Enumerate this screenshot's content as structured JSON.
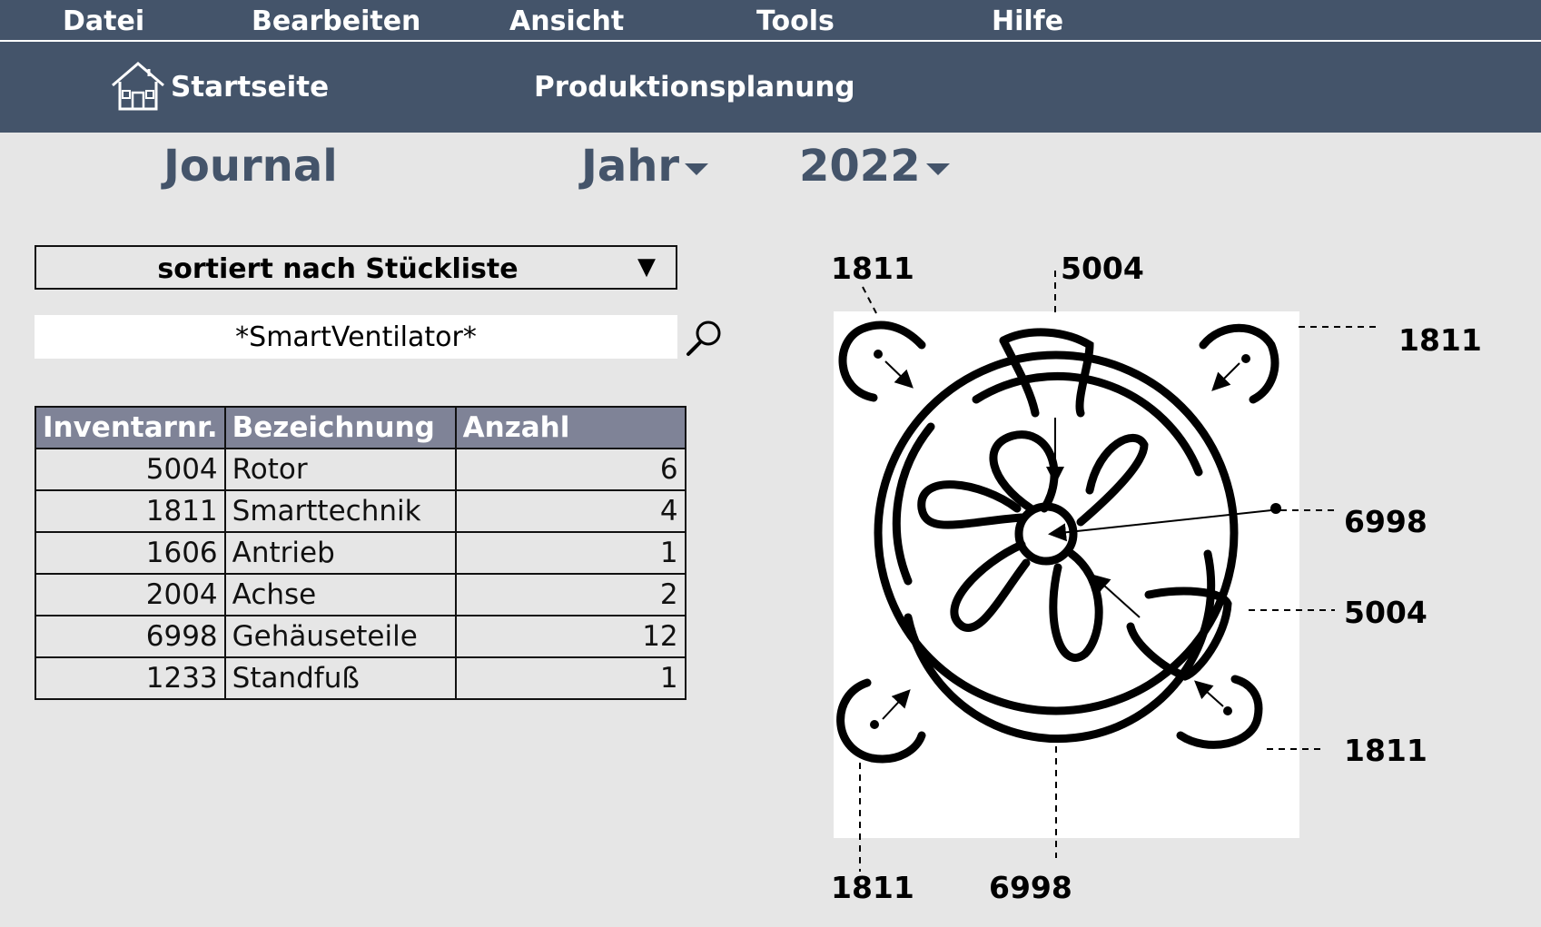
{
  "menu": {
    "items": [
      "Datei",
      "Bearbeiten",
      "Ansicht",
      "Tools",
      "Hilfe"
    ]
  },
  "nav": {
    "home_label": "Startseite",
    "production_label": "Produktionsplanung"
  },
  "header": {
    "journal": "Journal",
    "year_label": "Jahr",
    "year_value": "2022"
  },
  "sort": {
    "selected": "sortiert nach Stückliste",
    "arrow": "▼"
  },
  "search": {
    "value": "*SmartVentilator*"
  },
  "table": {
    "headers": [
      "Inventarnr.",
      "Bezeichnung",
      "Anzahl"
    ],
    "rows": [
      [
        "5004",
        "Rotor",
        "6"
      ],
      [
        "1811",
        "Smarttechnik",
        "4"
      ],
      [
        "1606",
        "Antrieb",
        "1"
      ],
      [
        "2004",
        "Achse",
        "2"
      ],
      [
        "6998",
        "Gehäuseteile",
        "12"
      ],
      [
        "1233",
        "Standfuß",
        "1"
      ]
    ]
  },
  "diagram": {
    "callouts": [
      "1811",
      "5004",
      "1811",
      "6998",
      "5004",
      "1811",
      "1811",
      "6998"
    ]
  },
  "colors": {
    "bar": "#44546a",
    "header_fill": "#7f8397",
    "background": "#e6e6e6"
  }
}
